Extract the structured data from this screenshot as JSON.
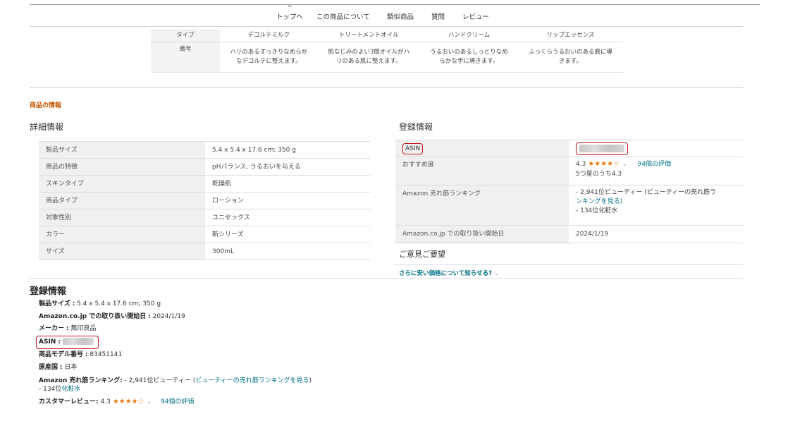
{
  "nav": {
    "top_label": "トップへ",
    "items": [
      "この商品について",
      "類似商品",
      "質問",
      "レビュー"
    ]
  },
  "comparison": {
    "row_labels": [
      "タイプ",
      "備考"
    ],
    "columns": [
      {
        "type": "デコルテミルク",
        "note_1": "ハリのあるすっきりなめらか",
        "note_2": "なデコルテに整えます。"
      },
      {
        "type": "トリートメントオイル",
        "note_1": "肌なじみのよい3層オイルがハ",
        "note_2": "リのある肌に整えます。"
      },
      {
        "type": "ハンドクリーム",
        "note_1": "うるおいのあるしっとりなめ",
        "note_2": "らかな手に導きます。"
      },
      {
        "type": "リップエッセンス",
        "note_1": "ふっくらうるおいのある唇に導",
        "note_2": "きます。"
      }
    ]
  },
  "product_info_label": "商品の情報",
  "detail": {
    "heading": "詳細情報",
    "rows": [
      {
        "k": "製品サイズ",
        "v": "5.4 x 5.4 x 17.6 cm; 350 g"
      },
      {
        "k": "商品の特徴",
        "v": "pHバランス, うるおいを与える"
      },
      {
        "k": "スキンタイプ",
        "v": "乾燥肌"
      },
      {
        "k": "商品タイプ",
        "v": "ローション"
      },
      {
        "k": "対象性別",
        "v": "ユニセックス"
      },
      {
        "k": "カラー",
        "v": "新シリーズ"
      },
      {
        "k": "サイズ",
        "v": "300mL"
      }
    ]
  },
  "registration": {
    "heading": "登録情報",
    "asin_label": "ASIN",
    "recommend_label": "おすすめ度",
    "rating": "4.3",
    "review_count": "94個の評価",
    "rating_text": "5つ星のうち4.3",
    "ranking_label": "Amazon 売れ筋ランキング",
    "ranking_line1": "- 2,941位ビューティー (ビューティーの売れ筋ラ",
    "ranking_line2": "ンキングを見る)",
    "ranking_line3": "- 134位化粧水",
    "date_label": "Amazon.co.jp での取り扱い開始日",
    "date_value": "2024/1/19"
  },
  "feedback": {
    "heading": "ご意見ご要望",
    "link": "さらに安い価格について知らせる?"
  },
  "registration2": {
    "heading": "登録情報",
    "size_label": "製品サイズ",
    "size_value": "5.4 x 5.4 x 17.6 cm; 350 g",
    "date_label": "Amazon.co.jp での取り扱い開始日",
    "date_value": "2024/1/19",
    "maker_label": "メーカー",
    "maker_value": "無印良品",
    "asin_label": "ASIN",
    "model_label": "商品モデル番号",
    "model_value": "83451141",
    "origin_label": "原産国",
    "origin_value": "日本",
    "ranking_label": "Amazon 売れ筋ランキング",
    "ranking_value": "- 2,941位ビューティー (",
    "ranking_link": "ビューティーの売れ筋ランキングを見る",
    "ranking_end": ")",
    "ranking_sub": "- 134位",
    "ranking_sub_link": "化粧水",
    "review_label": "カスタマーレビュー",
    "review_rating": "4.3",
    "review_count": "94個の評価"
  },
  "colors": {
    "accent": "#c45500",
    "link": "#007185",
    "star": "#e47911",
    "highlight_box": "#c7171e"
  },
  "icons": {
    "star": "star-icon",
    "chevron": "chevron-down-icon",
    "up": "chevron-up-icon"
  }
}
